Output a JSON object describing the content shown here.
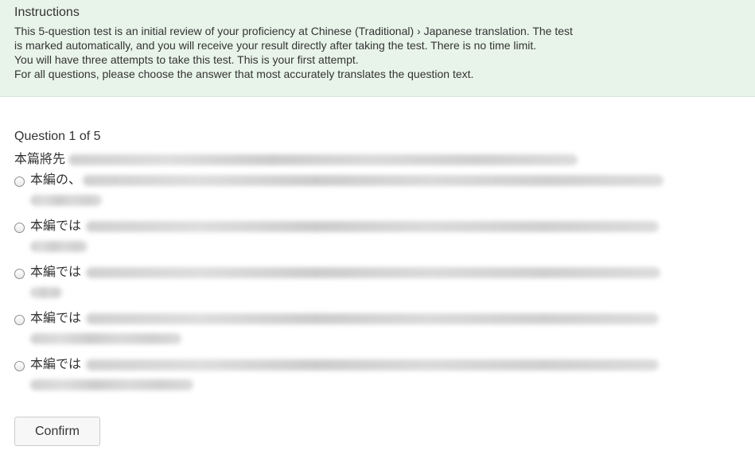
{
  "instructions": {
    "title": "Instructions",
    "lines": [
      "This 5-question test is an initial review of your proficiency at Chinese (Traditional) › Japanese translation. The test is marked automatically, and you will receive your result directly after taking the test. There is no time limit.",
      "You will have three attempts to take this test. This is your first attempt.",
      "For all questions, please choose the answer that most accurately translates the question text."
    ]
  },
  "question": {
    "heading": "Question 1 of 5",
    "text_visible": "本篇將先",
    "options": [
      {
        "visible": "本編の、"
      },
      {
        "visible": "本編では"
      },
      {
        "visible": "本編では"
      },
      {
        "visible": "本編では"
      },
      {
        "visible": "本編では"
      }
    ]
  },
  "actions": {
    "confirm_label": "Confirm"
  }
}
